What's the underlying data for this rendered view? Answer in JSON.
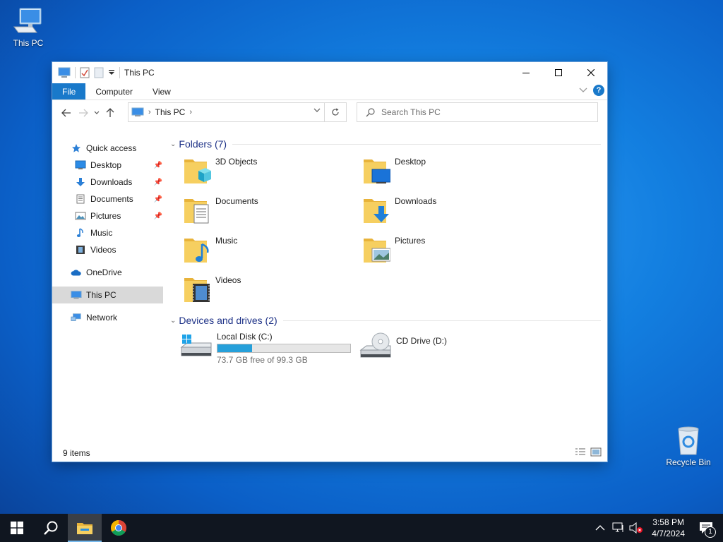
{
  "desktop": {
    "this_pc": "This PC",
    "recycle_bin": "Recycle Bin"
  },
  "window": {
    "title": "This PC",
    "ribbon_tabs": [
      "File",
      "Computer",
      "View"
    ],
    "help_label": "?",
    "address": {
      "crumb": "This PC"
    },
    "search": {
      "placeholder": "Search This PC"
    },
    "sidebar": {
      "quick_access": "Quick access",
      "quick_items": [
        {
          "label": "Desktop",
          "icon": "desktop-icon",
          "pinned": true
        },
        {
          "label": "Downloads",
          "icon": "downloads-icon",
          "pinned": true
        },
        {
          "label": "Documents",
          "icon": "documents-icon",
          "pinned": true
        },
        {
          "label": "Pictures",
          "icon": "pictures-icon",
          "pinned": true
        },
        {
          "label": "Music",
          "icon": "music-icon",
          "pinned": false
        },
        {
          "label": "Videos",
          "icon": "videos-icon",
          "pinned": false
        }
      ],
      "onedrive": "OneDrive",
      "this_pc": "This PC",
      "network": "Network"
    },
    "folders_header": "Folders (7)",
    "folders": [
      {
        "label": "3D Objects"
      },
      {
        "label": "Desktop"
      },
      {
        "label": "Documents"
      },
      {
        "label": "Downloads"
      },
      {
        "label": "Music"
      },
      {
        "label": "Pictures"
      },
      {
        "label": "Videos"
      }
    ],
    "drives_header": "Devices and drives (2)",
    "drives": [
      {
        "label": "Local Disk (C:)",
        "free_text": "73.7 GB free of 99.3 GB",
        "used_fraction": 0.258
      },
      {
        "label": "CD Drive (D:)"
      }
    ],
    "status": {
      "item_count": "9 items"
    }
  },
  "taskbar": {
    "time": "3:58 PM",
    "date": "4/7/2024",
    "notification_count": "1"
  },
  "colors": {
    "accent": "#1979ca",
    "folder": "#f3c34a",
    "drive_bar": "#26a0da",
    "taskbar": "#101620"
  }
}
